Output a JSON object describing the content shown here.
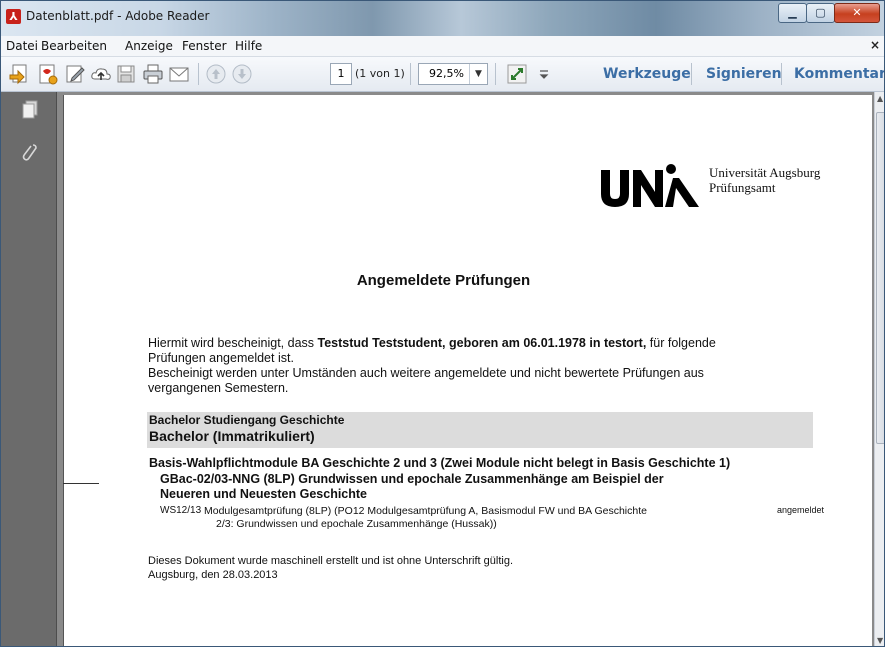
{
  "window": {
    "title": "Datenblatt.pdf - Adobe Reader",
    "app_icon": "adobe-reader-icon"
  },
  "menubar": {
    "items": [
      "Datei",
      "Bearbeiten",
      "Anzeige",
      "Fenster",
      "Hilfe"
    ],
    "close_glyph": "×"
  },
  "toolbar": {
    "page_current": "1",
    "page_of": "(1 von 1)",
    "zoom": "92,5%",
    "tools_label": "Werkzeuge",
    "sign_label": "Signieren",
    "comment_label": "Kommentar"
  },
  "document": {
    "institution_line1": "Universität Augsburg",
    "institution_line2": "Prüfungsamt",
    "heading": "Angemeldete Prüfungen",
    "intro_pre": "Hiermit wird bescheinigt, dass ",
    "intro_bold": "Teststud Teststudent, geboren am 06.01.1978 in testort,",
    "intro_post": " für folgende",
    "intro_line2": "Prüfungen angemeldet ist.",
    "note_line1": "Bescheinigt werden unter Umständen auch weitere angemeldete und nicht bewertete Prüfungen aus",
    "note_line2": "vergangenen Semestern.",
    "program_line1": "Bachelor Studiengang Geschichte",
    "program_line2": "Bachelor (Immatrikuliert)",
    "module_group": "Basis-Wahlpflichtmodule BA Geschichte 2 und 3 (Zwei Module nicht belegt in Basis Geschichte 1)",
    "module_line1": "GBac-02/03-NNG (8LP) Grundwissen und epochale Zusammenhänge am Beispiel der",
    "module_line2": "Neueren und Neuesten Geschichte",
    "exam_semester": "WS12/13",
    "exam_line1": "Modulgesamtprüfung (8LP) (PO12 Modulgesamtprüfung A, Basismodul FW und BA Geschichte",
    "exam_line2": "2/3: Grundwissen und epochale Zusammenhänge (Hussak))",
    "exam_status": "angemeldet",
    "footer_line1": "Dieses Dokument wurde maschinell erstellt und ist ohne Unterschrift gültig.",
    "footer_line2": "Augsburg, den 28.03.2013"
  },
  "icons": [
    "create-pdf-icon",
    "open-icon",
    "edit-icon",
    "upload-cloud-icon",
    "save-icon",
    "print-icon",
    "email-icon",
    "prev-page-icon",
    "next-page-icon",
    "fit-page-icon",
    "toolbar-options-icon",
    "pages-panel-icon",
    "attachments-icon"
  ]
}
